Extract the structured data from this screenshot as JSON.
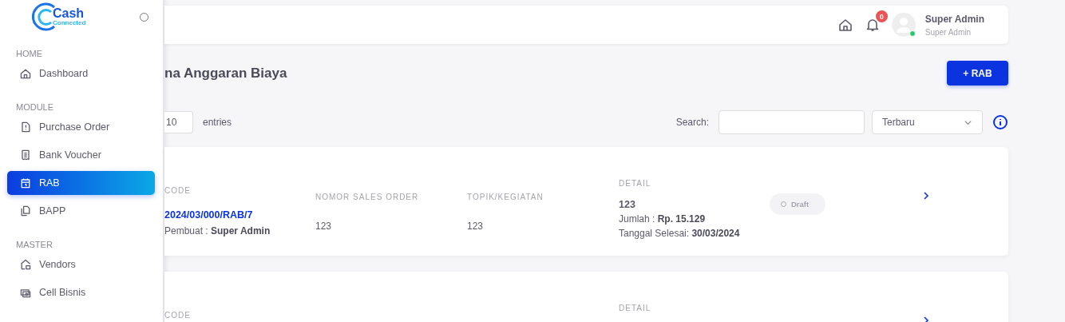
{
  "logo": {
    "title": "Cash",
    "subtitle": "Connected"
  },
  "sidebar": {
    "sections": [
      {
        "heading": "HOME",
        "items": [
          {
            "label": "Dashboard",
            "selected": false
          }
        ]
      },
      {
        "heading": "MODULE",
        "items": [
          {
            "label": "Purchase Order",
            "selected": false
          },
          {
            "label": "Bank Voucher",
            "selected": false
          },
          {
            "label": "RAB",
            "selected": true
          },
          {
            "label": "BAPP",
            "selected": false
          }
        ]
      },
      {
        "heading": "MASTER",
        "items": [
          {
            "label": "Vendors",
            "selected": false
          },
          {
            "label": "Cell Bisnis",
            "selected": false
          }
        ]
      }
    ]
  },
  "header": {
    "notifications": "0",
    "user_name": "Super Admin",
    "user_role": "Super Admin",
    "online": true
  },
  "page_title": "na Anggaran Biaya",
  "add_button": "+ RAB",
  "entries": {
    "value": "10",
    "label": "entries"
  },
  "search": {
    "label": "Search:"
  },
  "sort": {
    "value": "Terbaru"
  },
  "rows": [
    {
      "code_label": "CODE",
      "code": "2024/03/000/RAB/7",
      "creator_label": "Pembuat :",
      "creator": "Super Admin",
      "so_label": "NOMOR SALES ORDER",
      "so": "123",
      "topic_label": "TOPIK/KEGIATAN",
      "topic": "123",
      "detail_label": "DETAIL",
      "detail_title": "123",
      "amount_label": "Jumlah  :",
      "amount": "Rp. 15.129",
      "date_label": "Tanggal Selesai:",
      "date": "30/03/2024",
      "status": "Draft"
    },
    {
      "code_label": "CODE",
      "detail_label": "DETAIL"
    }
  ]
}
